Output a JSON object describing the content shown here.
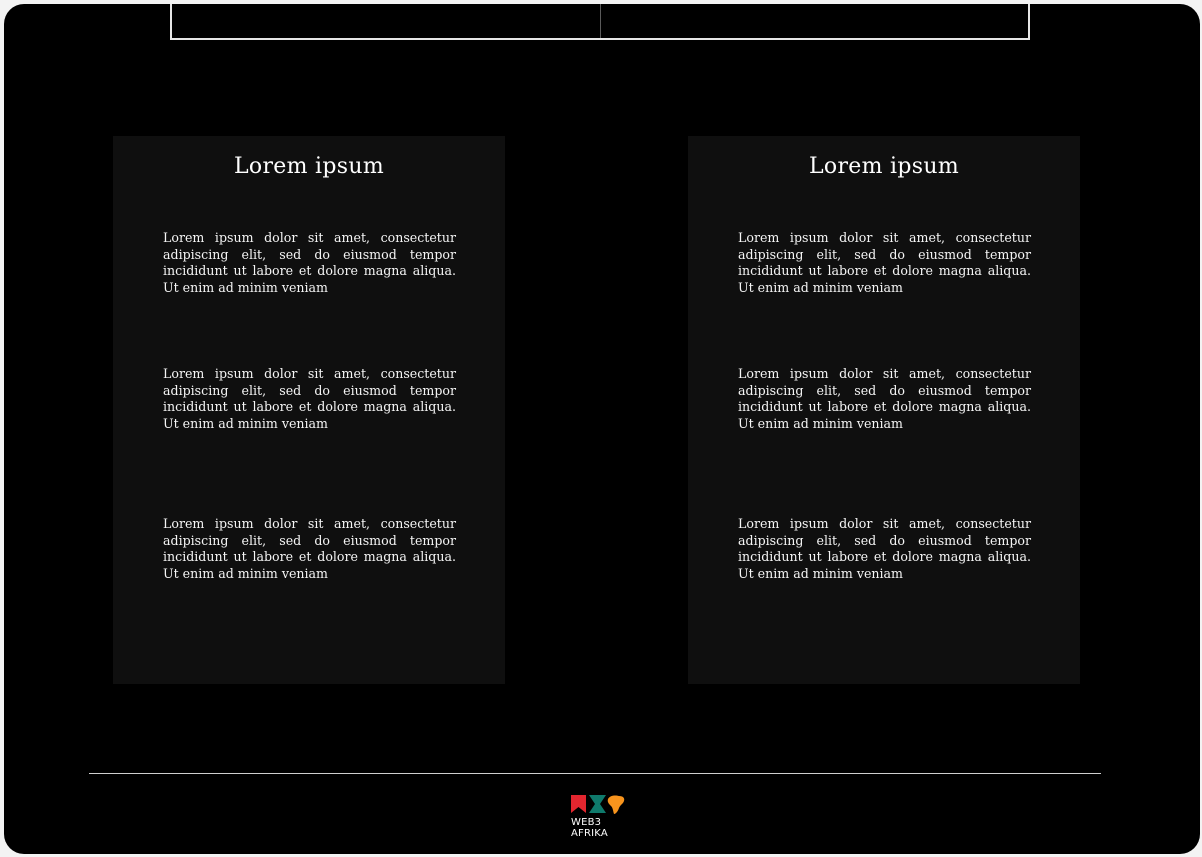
{
  "cards": [
    {
      "title": "Lorem ipsum",
      "paragraphs": [
        "Lorem ipsum dolor sit amet, consectetur adipiscing elit, sed do eiusmod tempor incididunt ut labore et dolore magna aliqua. Ut enim ad minim veniam",
        "Lorem ipsum dolor sit amet, consectetur adipiscing elit, sed do eiusmod tempor incididunt ut labore et dolore magna aliqua. Ut enim ad minim veniam",
        "Lorem ipsum dolor sit amet, consectetur adipiscing elit, sed do eiusmod tempor incididunt ut labore et dolore magna aliqua. Ut enim ad minim veniam"
      ]
    },
    {
      "title": "Lorem ipsum",
      "paragraphs": [
        "Lorem ipsum dolor sit amet, consectetur adipiscing elit, sed do eiusmod tempor incididunt ut labore et dolore magna aliqua. Ut enim ad minim veniam",
        "Lorem ipsum dolor sit amet, consectetur adipiscing elit, sed do eiusmod tempor incididunt ut labore et dolore magna aliqua. Ut enim ad minim veniam",
        "Lorem ipsum dolor sit amet, consectetur adipiscing elit, sed do eiusmod tempor incididunt ut labore et dolore magna aliqua. Ut enim ad minim veniam"
      ]
    }
  ],
  "footer": {
    "logo_line1": "WEB3",
    "logo_line2": "AFRIKA",
    "logo_icon": "web3-afrika-logo-icon",
    "logo_colors": [
      "#e3262f",
      "#0f7a6c",
      "#f7941d"
    ]
  },
  "colors": {
    "background": "#000000",
    "card": "#0f0f0f",
    "text": "#ffffff",
    "divider": "#cfcfcf"
  }
}
